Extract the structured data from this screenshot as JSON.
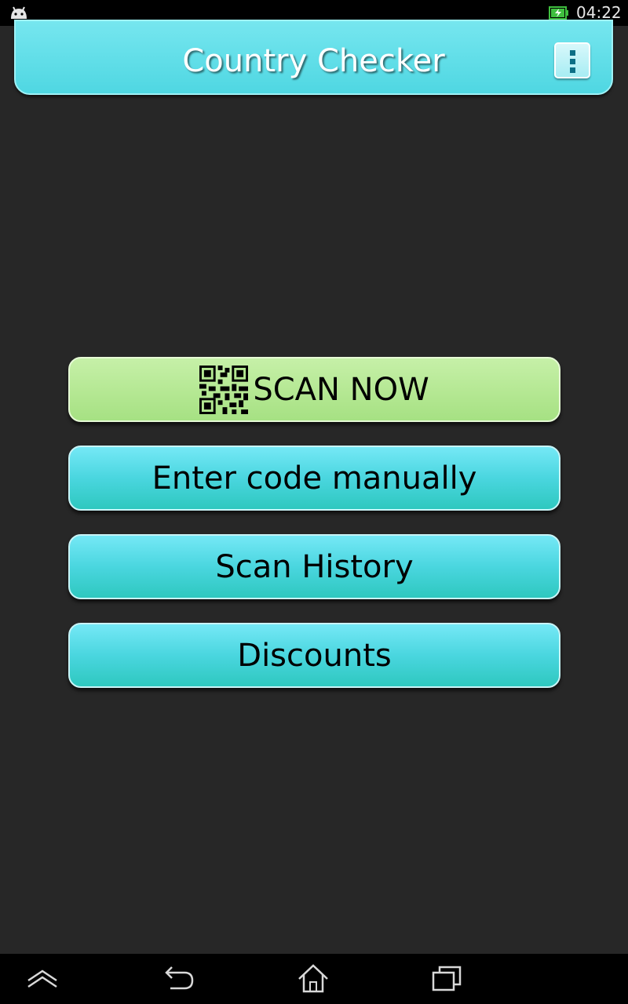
{
  "status_bar": {
    "time": "04:22",
    "icons": [
      "android-debug-icon",
      "battery-charging-icon"
    ]
  },
  "header": {
    "title": "Country Checker",
    "menu_icon": "overflow-menu-icon"
  },
  "buttons": {
    "scan_now": {
      "label": "SCAN NOW",
      "icon": "qr-code-icon"
    },
    "enter_code": {
      "label": "Enter code manually"
    },
    "scan_history": {
      "label": "Scan History"
    },
    "discounts": {
      "label": "Discounts"
    }
  },
  "nav_bar": {
    "icons": [
      "collapse-icon",
      "back-icon",
      "home-icon",
      "recent-apps-icon"
    ]
  },
  "colors": {
    "header": "#5ad9e4",
    "primary_button": "#4ad6df",
    "scan_button": "#b3e791",
    "background": "#272727"
  }
}
